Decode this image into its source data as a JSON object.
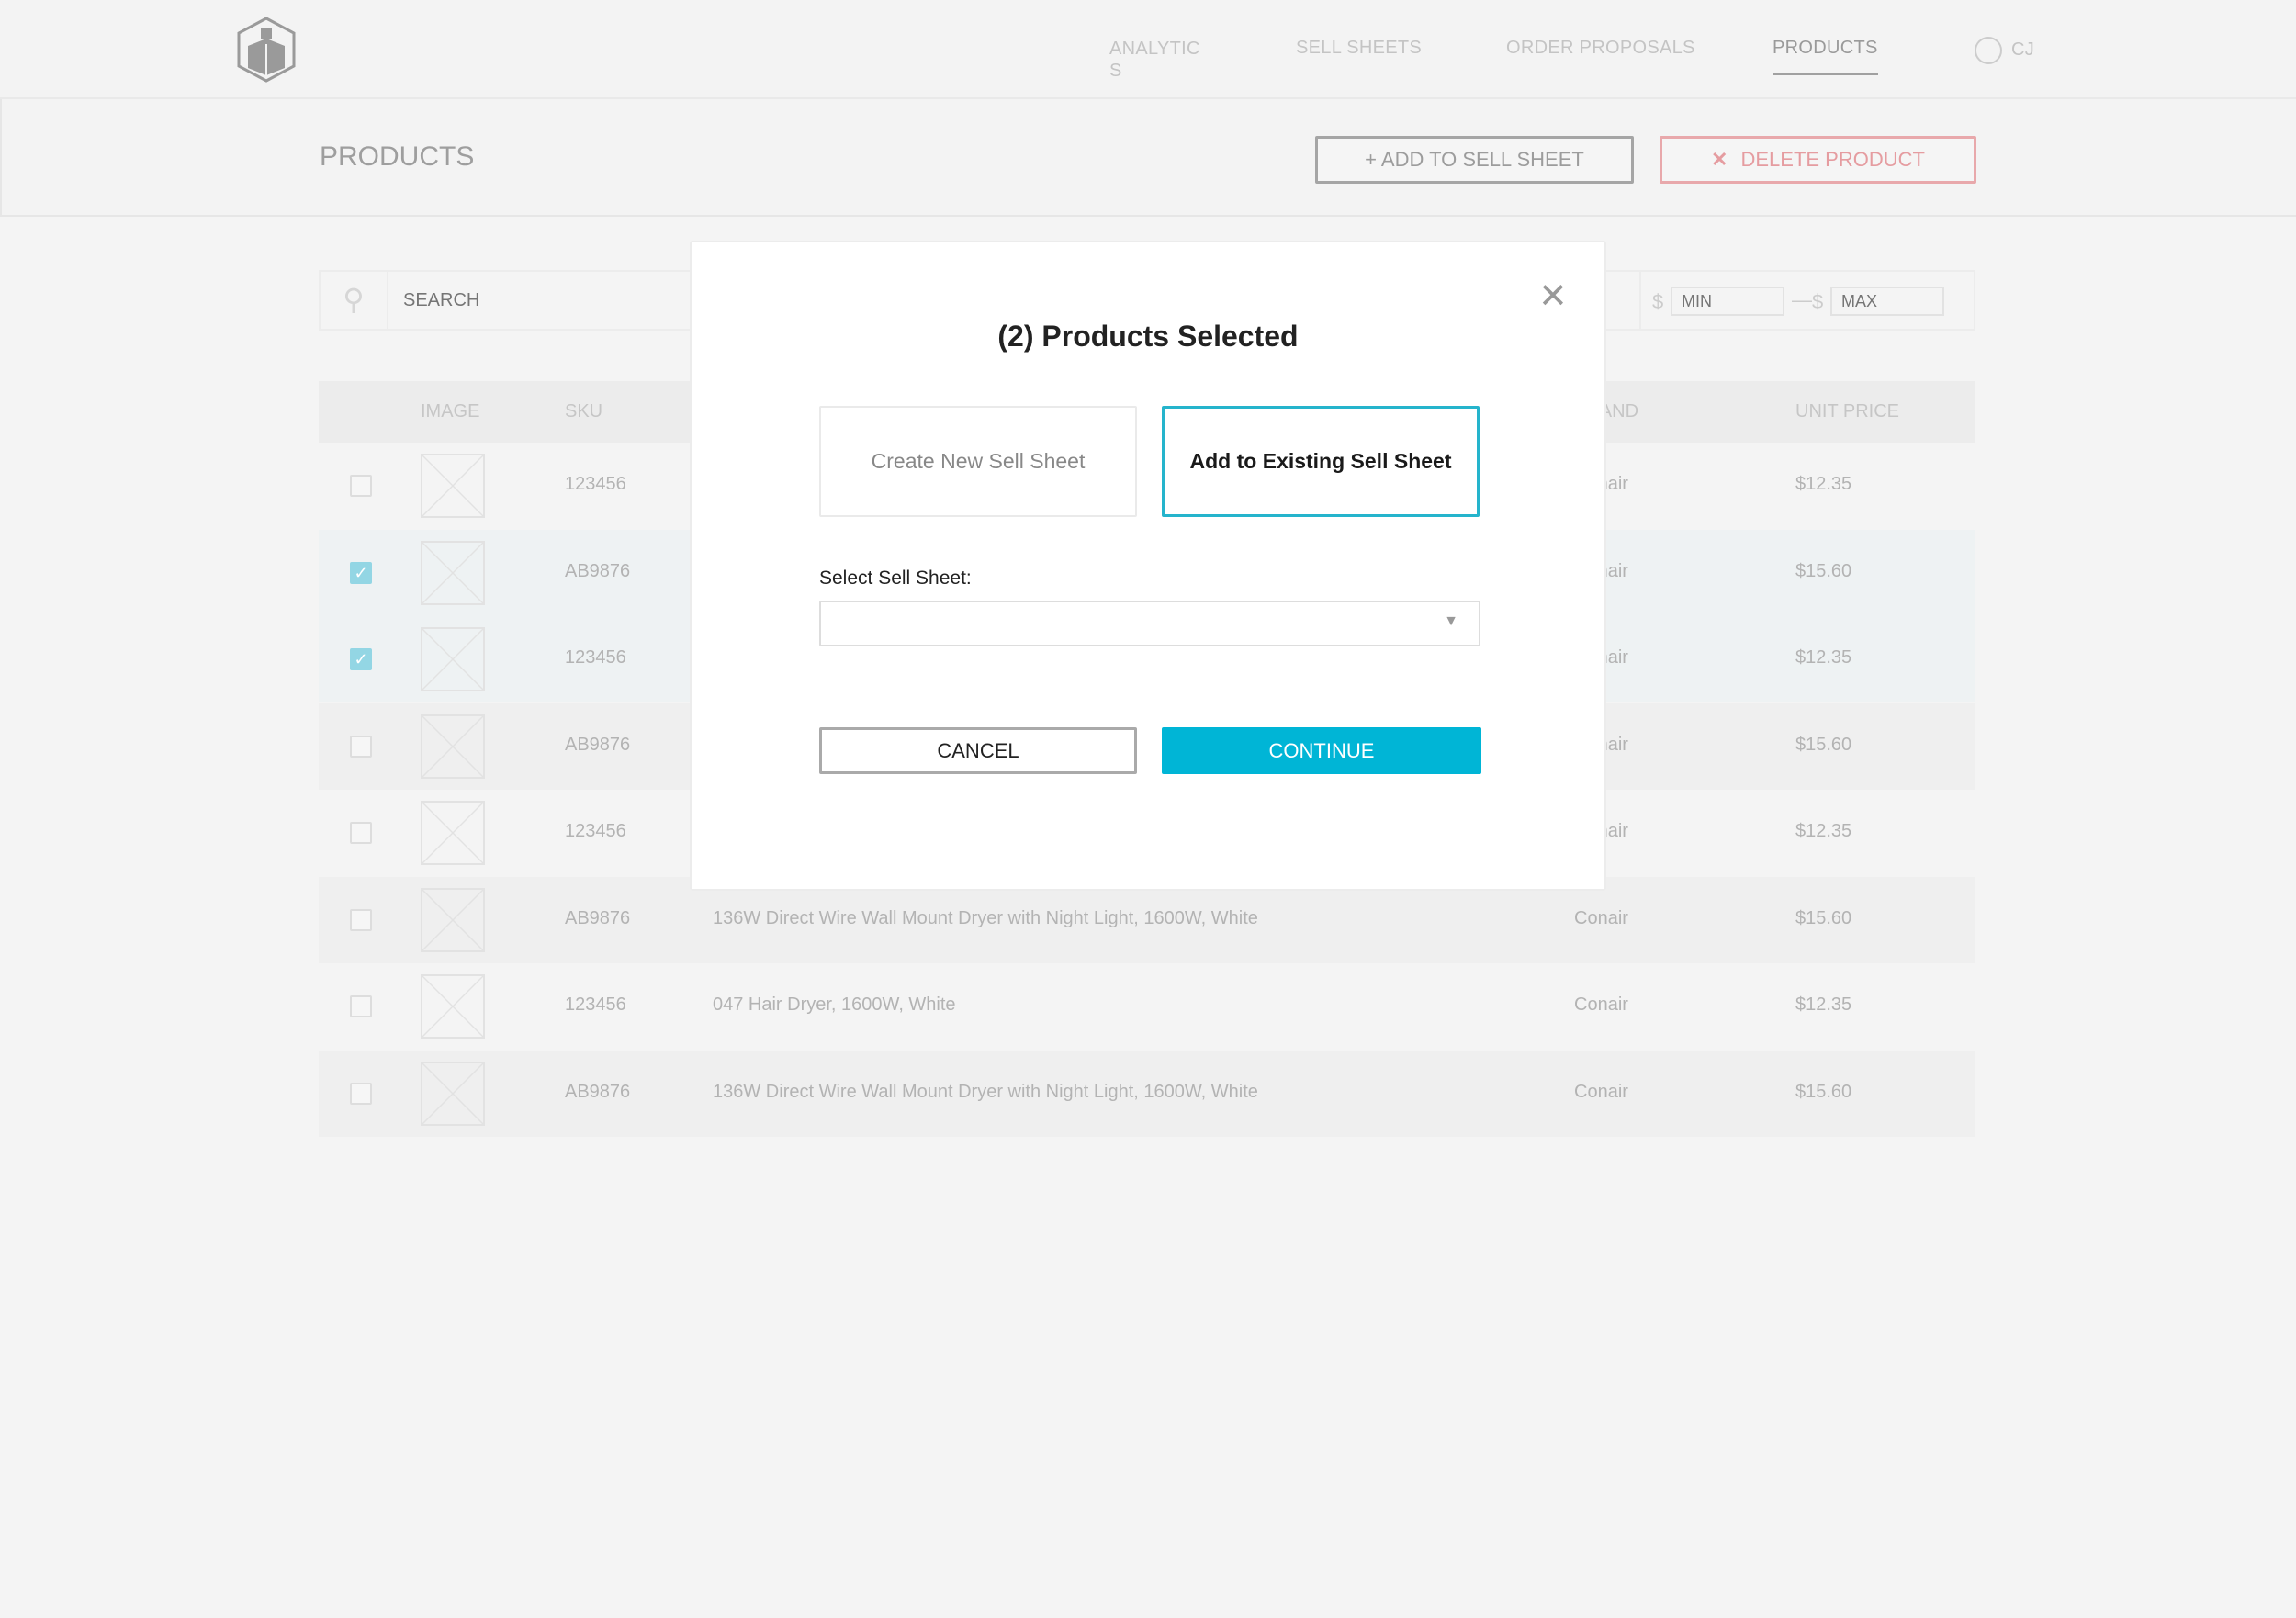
{
  "nav": {
    "items": [
      "ANALYTICS",
      "SELL SHEETS",
      "ORDER PROPOSALS",
      "PRODUCTS"
    ],
    "active": "PRODUCTS",
    "user": "CJ"
  },
  "page": {
    "title": "PRODUCTS",
    "add_label": "+ ADD TO SELL SHEET",
    "delete_label": "DELETE PRODUCT"
  },
  "filters": {
    "search_placeholder": "SEARCH",
    "currency": "$",
    "min_placeholder": "MIN",
    "max_placeholder": "MAX"
  },
  "table": {
    "headers": {
      "image": "IMAGE",
      "sku": "SKU",
      "brand": "BRAND",
      "price": "UNIT PRICE"
    },
    "rows": [
      {
        "checked": false,
        "sku": "123456",
        "description": "",
        "brand": "Conair",
        "price": "$12.35"
      },
      {
        "checked": true,
        "sku": "AB9876",
        "description": "",
        "brand": "Conair",
        "price": "$15.60"
      },
      {
        "checked": true,
        "sku": "123456",
        "description": "",
        "brand": "Conair",
        "price": "$12.35"
      },
      {
        "checked": false,
        "sku": "AB9876",
        "description": "",
        "brand": "Conair",
        "price": "$15.60"
      },
      {
        "checked": false,
        "sku": "123456",
        "description": "",
        "brand": "Conair",
        "price": "$12.35"
      },
      {
        "checked": false,
        "sku": "AB9876",
        "description": "136W Direct Wire Wall Mount Dryer with Night Light, 1600W, White",
        "brand": "Conair",
        "price": "$15.60"
      },
      {
        "checked": false,
        "sku": "123456",
        "description": "047 Hair Dryer, 1600W, White",
        "brand": "Conair",
        "price": "$12.35"
      },
      {
        "checked": false,
        "sku": "AB9876",
        "description": "136W Direct Wire Wall Mount Dryer with Night Light, 1600W, White",
        "brand": "Conair",
        "price": "$15.60"
      }
    ]
  },
  "modal": {
    "title": "(2) Products Selected",
    "option_new": "Create New Sell Sheet",
    "option_existing": "Add to Existing Sell Sheet",
    "selected_option": "Add to Existing Sell Sheet",
    "select_label": "Select Sell Sheet:",
    "select_value": "",
    "cancel": "CANCEL",
    "continue": "CONTINUE"
  },
  "colors": {
    "accent": "#00b5d6",
    "delete": "#e59ca0"
  }
}
